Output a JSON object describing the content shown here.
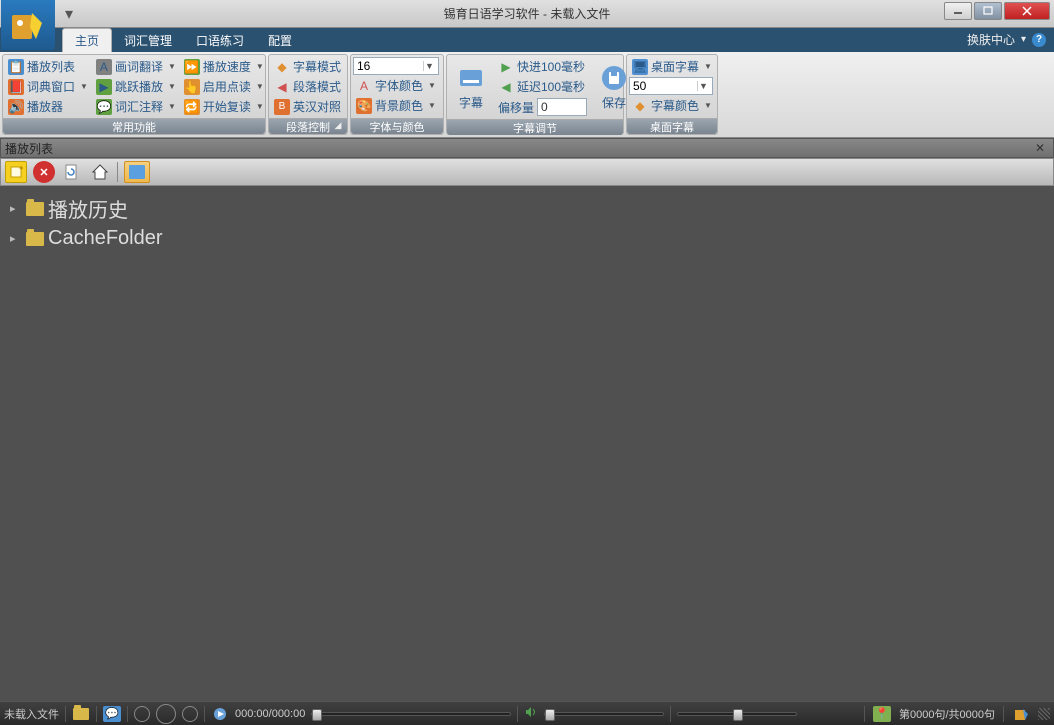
{
  "title": "锡育日语学习软件 - 未载入文件",
  "menu": {
    "tabs": [
      "主页",
      "词汇管理",
      "口语练习",
      "配置"
    ],
    "active": 0,
    "skin_center": "换肤中心"
  },
  "ribbon": {
    "group1": {
      "label": "常用功能",
      "col1": [
        "播放列表",
        "词典窗口",
        "播放器"
      ],
      "col2": [
        "画词翻译",
        "跳跃播放",
        "词汇注释"
      ],
      "col3": [
        "播放速度",
        "启用点读",
        "开始复读"
      ]
    },
    "group2": {
      "label": "段落控制",
      "items": [
        "字幕模式",
        "段落模式",
        "英汉对照"
      ]
    },
    "group3": {
      "label": "字体与颜色",
      "font_size": "16",
      "items": [
        "字体颜色",
        "背景颜色"
      ]
    },
    "group4": {
      "label": "字幕调节",
      "subtitle_btn": "字幕",
      "fast": "快进100毫秒",
      "slow": "延迟100毫秒",
      "offset_label": "偏移量",
      "offset_value": "0",
      "save": "保存"
    },
    "group5": {
      "label": "桌面字幕",
      "toggle": "桌面字幕",
      "size": "50",
      "color": "字幕颜色"
    }
  },
  "panel": {
    "title": "播放列表",
    "tree": [
      "播放历史",
      "CacheFolder"
    ]
  },
  "status": {
    "file": "未载入文件",
    "time": "000:00/000:00",
    "counter": "第0000句/共0000句"
  }
}
